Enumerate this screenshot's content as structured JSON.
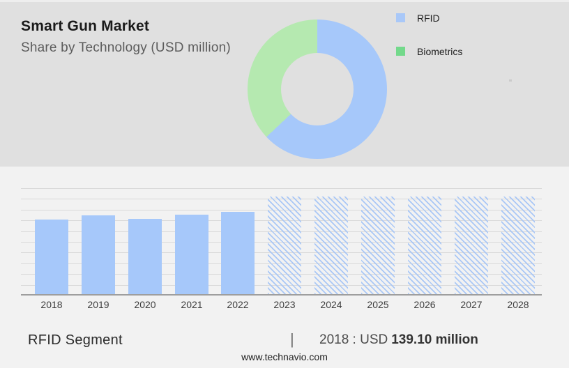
{
  "header": {
    "title": "Smart Gun Market",
    "subtitle": "Share by Technology (USD million)"
  },
  "legend": {
    "items": [
      {
        "label": "RFID",
        "color": "#a9c8f8"
      },
      {
        "label": "Biometrics",
        "color": "#73d98b"
      }
    ]
  },
  "colors": {
    "top_bg": "#e0e0e0",
    "bottom_bg": "#f2f2f2",
    "grid": "#d9d9d9",
    "axis": "#9e9e9e",
    "bar_blue": "#a6c8fa",
    "hatch_blue": "#a9c7f6",
    "donut_blue": "#a6c8fa",
    "donut_green": "#b5e9b0"
  },
  "chart_data": [
    {
      "type": "pie",
      "subtype": "donut",
      "title": "Smart Gun Market — Share by Technology (USD million)",
      "slices": [
        {
          "label": "RFID",
          "pct": 63,
          "color": "#a6c8fa"
        },
        {
          "label": "Biometrics",
          "pct": 37,
          "color": "#b5e9b0"
        }
      ],
      "legend_position": "right"
    },
    {
      "type": "bar",
      "title": "RFID Segment (USD million)",
      "categories": [
        "2018",
        "2019",
        "2020",
        "2021",
        "2022",
        "2023",
        "2024",
        "2025",
        "2026",
        "2027",
        "2028"
      ],
      "values": [
        139.1,
        146.8,
        140.3,
        148.1,
        153.2,
        182,
        182,
        182,
        182,
        182,
        182
      ],
      "forecast_start": "2023",
      "annotation": "2018 : USD 139.10 million",
      "xlabel": "",
      "ylabel": "",
      "ylim": [
        0,
        200
      ],
      "grid": true,
      "note": "2023-2028 bars are equal-height hatched forecast placeholders"
    }
  ],
  "footer": {
    "segment_label": "RFID Segment",
    "separator": "|",
    "value_year_prefix": "2018 : USD",
    "value_bold": "139.10 million",
    "website": "www.technavio.com"
  }
}
